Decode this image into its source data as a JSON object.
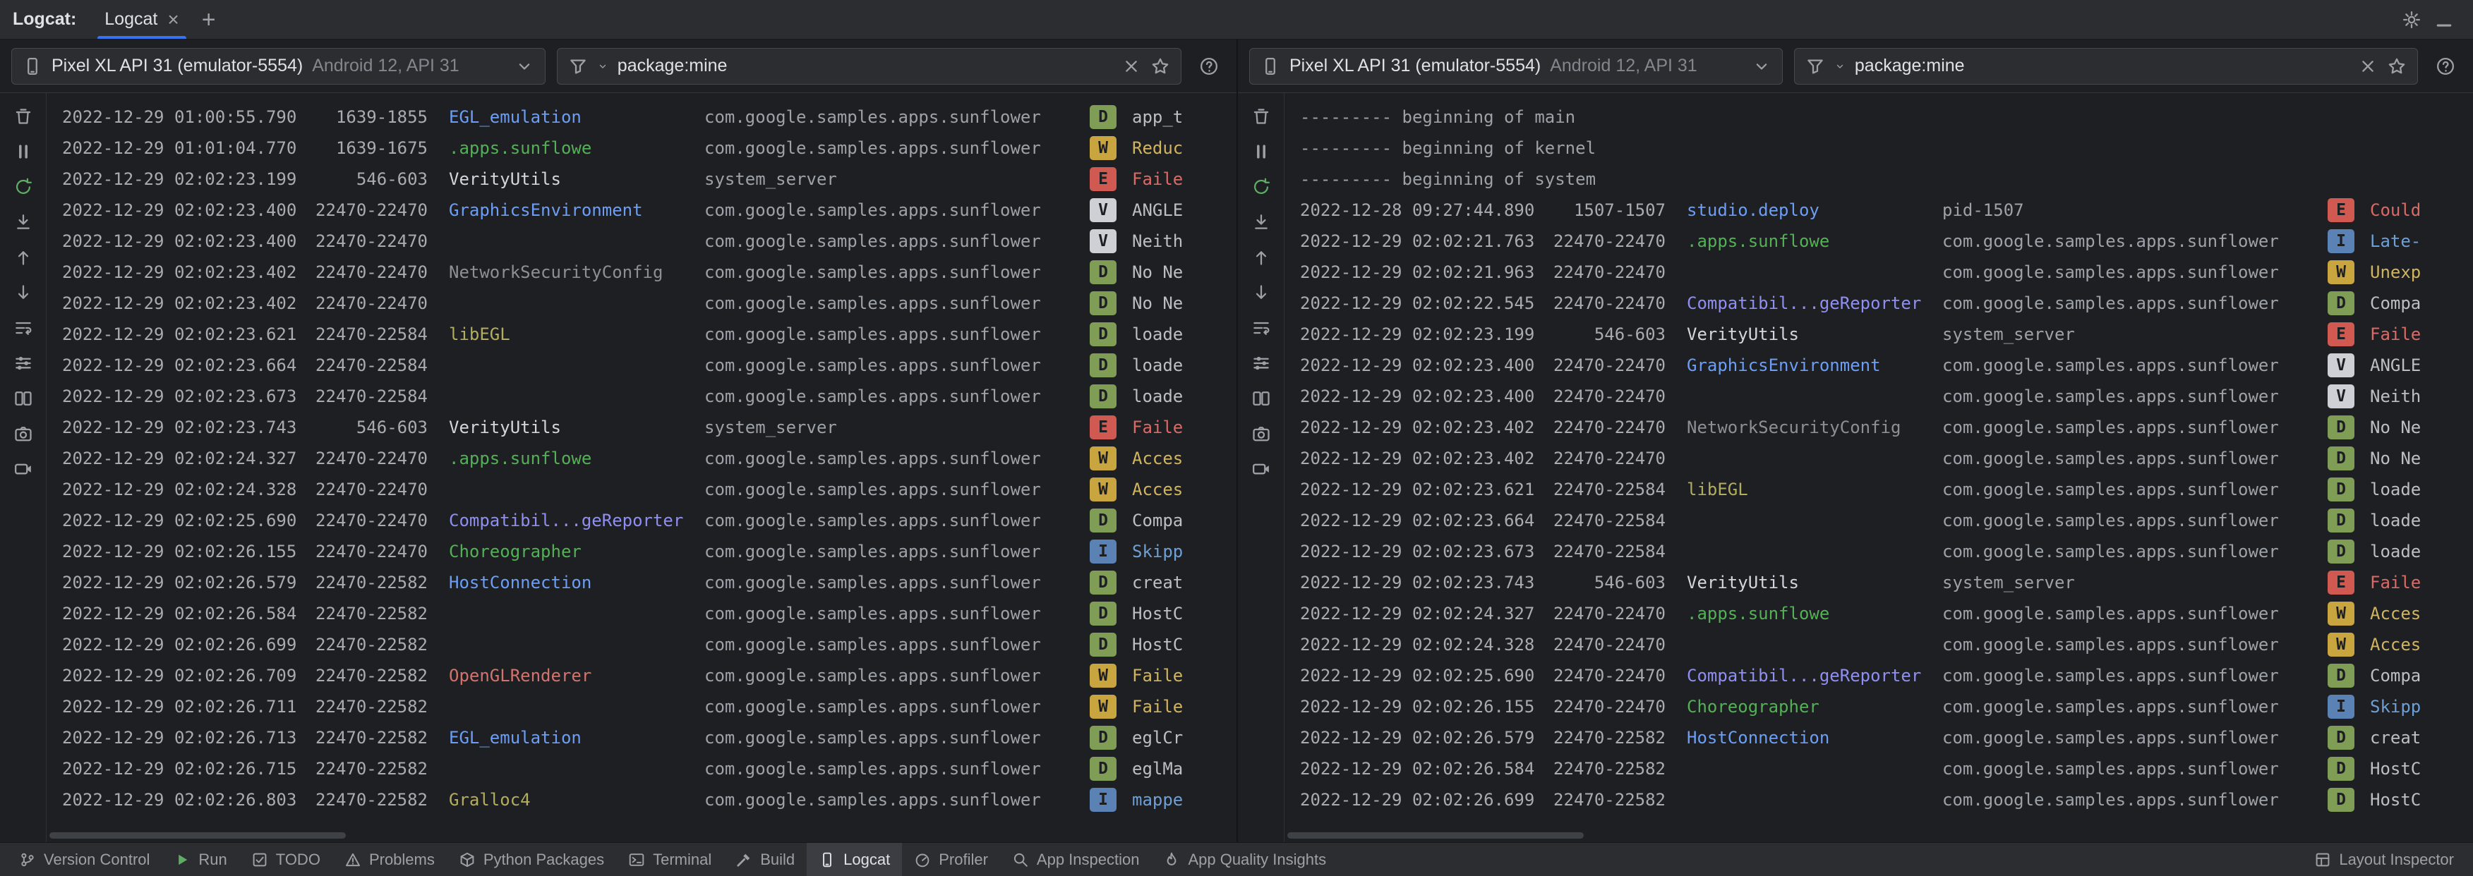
{
  "tab_bar": {
    "tool_window_label": "Logcat:",
    "tab": {
      "label": "Logcat",
      "close_glyph": "×"
    },
    "add_tab_glyph": "+"
  },
  "gutter_icons": [
    "clear-logcat",
    "pause-logcat",
    "restart-logcat",
    "scroll-to-end",
    "previous-occurrence",
    "next-occurrence",
    "soft-wrap",
    "configure-logcat",
    "split-panels",
    "take-screenshot",
    "record-screen"
  ],
  "panes": [
    {
      "device": {
        "name": "Pixel XL API 31 (emulator-5554)",
        "details": "Android 12, API 31"
      },
      "filter": {
        "value": "package:mine"
      },
      "rows": [
        {
          "time": "2022-12-29 01:00:55.790",
          "pid": "1639-1855",
          "tag": "EGL_emulation",
          "tag_color": "blue",
          "package": "com.google.samples.apps.sunflower",
          "level": "D",
          "message": "app_t"
        },
        {
          "time": "2022-12-29 01:01:04.770",
          "pid": "1639-1675",
          "tag": ".apps.sunflowe",
          "tag_color": "green",
          "package": "com.google.samples.apps.sunflower",
          "level": "W",
          "message": "Reduc"
        },
        {
          "time": "2022-12-29 02:02:23.199",
          "pid": "546-603",
          "tag": "VerityUtils",
          "tag_color": "default",
          "package": "system_server",
          "level": "E",
          "message": "Faile"
        },
        {
          "time": "2022-12-29 02:02:23.400",
          "pid": "22470-22470",
          "tag": "GraphicsEnvironment",
          "tag_color": "blue",
          "package": "com.google.samples.apps.sunflower",
          "level": "V",
          "message": "ANGLE"
        },
        {
          "time": "2022-12-29 02:02:23.400",
          "pid": "22470-22470",
          "tag": "",
          "tag_color": "default",
          "package": "com.google.samples.apps.sunflower",
          "level": "V",
          "message": "Neith"
        },
        {
          "time": "2022-12-29 02:02:23.402",
          "pid": "22470-22470",
          "tag": "NetworkSecurityConfig",
          "tag_color": "gray",
          "package": "com.google.samples.apps.sunflower",
          "level": "D",
          "message": "No Ne"
        },
        {
          "time": "2022-12-29 02:02:23.402",
          "pid": "22470-22470",
          "tag": "",
          "tag_color": "default",
          "package": "com.google.samples.apps.sunflower",
          "level": "D",
          "message": "No Ne"
        },
        {
          "time": "2022-12-29 02:02:23.621",
          "pid": "22470-22584",
          "tag": "libEGL",
          "tag_color": "yellow",
          "package": "com.google.samples.apps.sunflower",
          "level": "D",
          "message": "loade"
        },
        {
          "time": "2022-12-29 02:02:23.664",
          "pid": "22470-22584",
          "tag": "",
          "tag_color": "default",
          "package": "com.google.samples.apps.sunflower",
          "level": "D",
          "message": "loade"
        },
        {
          "time": "2022-12-29 02:02:23.673",
          "pid": "22470-22584",
          "tag": "",
          "tag_color": "default",
          "package": "com.google.samples.apps.sunflower",
          "level": "D",
          "message": "loade"
        },
        {
          "time": "2022-12-29 02:02:23.743",
          "pid": "546-603",
          "tag": "VerityUtils",
          "tag_color": "default",
          "package": "system_server",
          "level": "E",
          "message": "Faile"
        },
        {
          "time": "2022-12-29 02:02:24.327",
          "pid": "22470-22470",
          "tag": ".apps.sunflowe",
          "tag_color": "green",
          "package": "com.google.samples.apps.sunflower",
          "level": "W",
          "message": "Acces"
        },
        {
          "time": "2022-12-29 02:02:24.328",
          "pid": "22470-22470",
          "tag": "",
          "tag_color": "default",
          "package": "com.google.samples.apps.sunflower",
          "level": "W",
          "message": "Acces"
        },
        {
          "time": "2022-12-29 02:02:25.690",
          "pid": "22470-22470",
          "tag": "Compatibil...geReporter",
          "tag_color": "indigo",
          "package": "com.google.samples.apps.sunflower",
          "level": "D",
          "message": "Compa"
        },
        {
          "time": "2022-12-29 02:02:26.155",
          "pid": "22470-22470",
          "tag": "Choreographer",
          "tag_color": "green",
          "package": "com.google.samples.apps.sunflower",
          "level": "I",
          "message": "Skipp"
        },
        {
          "time": "2022-12-29 02:02:26.579",
          "pid": "22470-22582",
          "tag": "HostConnection",
          "tag_color": "blue",
          "package": "com.google.samples.apps.sunflower",
          "level": "D",
          "message": "creat"
        },
        {
          "time": "2022-12-29 02:02:26.584",
          "pid": "22470-22582",
          "tag": "",
          "tag_color": "default",
          "package": "com.google.samples.apps.sunflower",
          "level": "D",
          "message": "HostC"
        },
        {
          "time": "2022-12-29 02:02:26.699",
          "pid": "22470-22582",
          "tag": "",
          "tag_color": "default",
          "package": "com.google.samples.apps.sunflower",
          "level": "D",
          "message": "HostC"
        },
        {
          "time": "2022-12-29 02:02:26.709",
          "pid": "22470-22582",
          "tag": "OpenGLRenderer",
          "tag_color": "red",
          "package": "com.google.samples.apps.sunflower",
          "level": "W",
          "message": "Faile"
        },
        {
          "time": "2022-12-29 02:02:26.711",
          "pid": "22470-22582",
          "tag": "",
          "tag_color": "default",
          "package": "com.google.samples.apps.sunflower",
          "level": "W",
          "message": "Faile"
        },
        {
          "time": "2022-12-29 02:02:26.713",
          "pid": "22470-22582",
          "tag": "EGL_emulation",
          "tag_color": "blue",
          "package": "com.google.samples.apps.sunflower",
          "level": "D",
          "message": "eglCr"
        },
        {
          "time": "2022-12-29 02:02:26.715",
          "pid": "22470-22582",
          "tag": "",
          "tag_color": "default",
          "package": "com.google.samples.apps.sunflower",
          "level": "D",
          "message": "eglMa"
        },
        {
          "time": "2022-12-29 02:02:26.803",
          "pid": "22470-22582",
          "tag": "Gralloc4",
          "tag_color": "yellow",
          "package": "com.google.samples.apps.sunflower",
          "level": "I",
          "message": "mappe"
        }
      ]
    },
    {
      "device": {
        "name": "Pixel XL API 31 (emulator-5554)",
        "details": "Android 12, API 31"
      },
      "filter": {
        "value": "package:mine"
      },
      "rows": [
        {
          "separator": "--------- beginning of main"
        },
        {
          "separator": "--------- beginning of kernel"
        },
        {
          "separator": "--------- beginning of system"
        },
        {
          "time": "2022-12-28 09:27:44.890",
          "pid": "1507-1507",
          "tag": "studio.deploy",
          "tag_color": "blue",
          "package": "pid-1507",
          "level": "E",
          "message": "Could"
        },
        {
          "time": "2022-12-29 02:02:21.763",
          "pid": "22470-22470",
          "tag": ".apps.sunflowe",
          "tag_color": "green",
          "package": "com.google.samples.apps.sunflower",
          "level": "I",
          "message": "Late-"
        },
        {
          "time": "2022-12-29 02:02:21.963",
          "pid": "22470-22470",
          "tag": "",
          "tag_color": "default",
          "package": "com.google.samples.apps.sunflower",
          "level": "W",
          "message": "Unexp"
        },
        {
          "time": "2022-12-29 02:02:22.545",
          "pid": "22470-22470",
          "tag": "Compatibil...geReporter",
          "tag_color": "indigo",
          "package": "com.google.samples.apps.sunflower",
          "level": "D",
          "message": "Compa"
        },
        {
          "time": "2022-12-29 02:02:23.199",
          "pid": "546-603",
          "tag": "VerityUtils",
          "tag_color": "default",
          "package": "system_server",
          "level": "E",
          "message": "Faile"
        },
        {
          "time": "2022-12-29 02:02:23.400",
          "pid": "22470-22470",
          "tag": "GraphicsEnvironment",
          "tag_color": "blue",
          "package": "com.google.samples.apps.sunflower",
          "level": "V",
          "message": "ANGLE"
        },
        {
          "time": "2022-12-29 02:02:23.400",
          "pid": "22470-22470",
          "tag": "",
          "tag_color": "default",
          "package": "com.google.samples.apps.sunflower",
          "level": "V",
          "message": "Neith"
        },
        {
          "time": "2022-12-29 02:02:23.402",
          "pid": "22470-22470",
          "tag": "NetworkSecurityConfig",
          "tag_color": "gray",
          "package": "com.google.samples.apps.sunflower",
          "level": "D",
          "message": "No Ne"
        },
        {
          "time": "2022-12-29 02:02:23.402",
          "pid": "22470-22470",
          "tag": "",
          "tag_color": "default",
          "package": "com.google.samples.apps.sunflower",
          "level": "D",
          "message": "No Ne"
        },
        {
          "time": "2022-12-29 02:02:23.621",
          "pid": "22470-22584",
          "tag": "libEGL",
          "tag_color": "yellow",
          "package": "com.google.samples.apps.sunflower",
          "level": "D",
          "message": "loade"
        },
        {
          "time": "2022-12-29 02:02:23.664",
          "pid": "22470-22584",
          "tag": "",
          "tag_color": "default",
          "package": "com.google.samples.apps.sunflower",
          "level": "D",
          "message": "loade"
        },
        {
          "time": "2022-12-29 02:02:23.673",
          "pid": "22470-22584",
          "tag": "",
          "tag_color": "default",
          "package": "com.google.samples.apps.sunflower",
          "level": "D",
          "message": "loade"
        },
        {
          "time": "2022-12-29 02:02:23.743",
          "pid": "546-603",
          "tag": "VerityUtils",
          "tag_color": "default",
          "package": "system_server",
          "level": "E",
          "message": "Faile"
        },
        {
          "time": "2022-12-29 02:02:24.327",
          "pid": "22470-22470",
          "tag": ".apps.sunflowe",
          "tag_color": "green",
          "package": "com.google.samples.apps.sunflower",
          "level": "W",
          "message": "Acces"
        },
        {
          "time": "2022-12-29 02:02:24.328",
          "pid": "22470-22470",
          "tag": "",
          "tag_color": "default",
          "package": "com.google.samples.apps.sunflower",
          "level": "W",
          "message": "Acces"
        },
        {
          "time": "2022-12-29 02:02:25.690",
          "pid": "22470-22470",
          "tag": "Compatibil...geReporter",
          "tag_color": "indigo",
          "package": "com.google.samples.apps.sunflower",
          "level": "D",
          "message": "Compa"
        },
        {
          "time": "2022-12-29 02:02:26.155",
          "pid": "22470-22470",
          "tag": "Choreographer",
          "tag_color": "green",
          "package": "com.google.samples.apps.sunflower",
          "level": "I",
          "message": "Skipp"
        },
        {
          "time": "2022-12-29 02:02:26.579",
          "pid": "22470-22582",
          "tag": "HostConnection",
          "tag_color": "blue",
          "package": "com.google.samples.apps.sunflower",
          "level": "D",
          "message": "creat"
        },
        {
          "time": "2022-12-29 02:02:26.584",
          "pid": "22470-22582",
          "tag": "",
          "tag_color": "default",
          "package": "com.google.samples.apps.sunflower",
          "level": "D",
          "message": "HostC"
        },
        {
          "time": "2022-12-29 02:02:26.699",
          "pid": "22470-22582",
          "tag": "",
          "tag_color": "default",
          "package": "com.google.samples.apps.sunflower",
          "level": "D",
          "message": "HostC"
        }
      ]
    }
  ],
  "status_bar": {
    "left": [
      {
        "label": "Version Control",
        "icon": "version-control"
      },
      {
        "label": "Run",
        "icon": "run"
      },
      {
        "label": "TODO",
        "icon": "todo"
      },
      {
        "label": "Problems",
        "icon": "problems"
      },
      {
        "label": "Python Packages",
        "icon": "python-packages"
      },
      {
        "label": "Terminal",
        "icon": "terminal"
      },
      {
        "label": "Build",
        "icon": "build"
      },
      {
        "label": "Logcat",
        "icon": "logcat",
        "active": true
      },
      {
        "label": "Profiler",
        "icon": "profiler"
      },
      {
        "label": "App Inspection",
        "icon": "app-inspection"
      },
      {
        "label": "App Quality Insights",
        "icon": "app-quality-insights"
      }
    ],
    "right": [
      {
        "label": "Layout Inspector",
        "icon": "layout-inspector"
      }
    ]
  },
  "colors": {
    "accent": "#3574f0",
    "restart-green": "#5fad65",
    "level-fg": "#1e1f22",
    "level-V-bg": "#ced0d6",
    "level-D-bg": "#7f9d54",
    "level-I-bg": "#5a82b5",
    "level-W-bg": "#c9a53f",
    "level-E-bg": "#d05a52",
    "msg-default": "#bcbec4",
    "msg-W": "#d0b45f",
    "msg-E": "#d96a66",
    "msg-I": "#6e9fd5",
    "tag-blue": "#6c9ef5",
    "tag-green": "#54b057",
    "tag-yellow": "#b2ad5f",
    "tag-gray": "#8c9096",
    "tag-red": "#d2736d",
    "tag-indigo": "#8f8ff0",
    "tag-default": "#d3d6dc"
  }
}
